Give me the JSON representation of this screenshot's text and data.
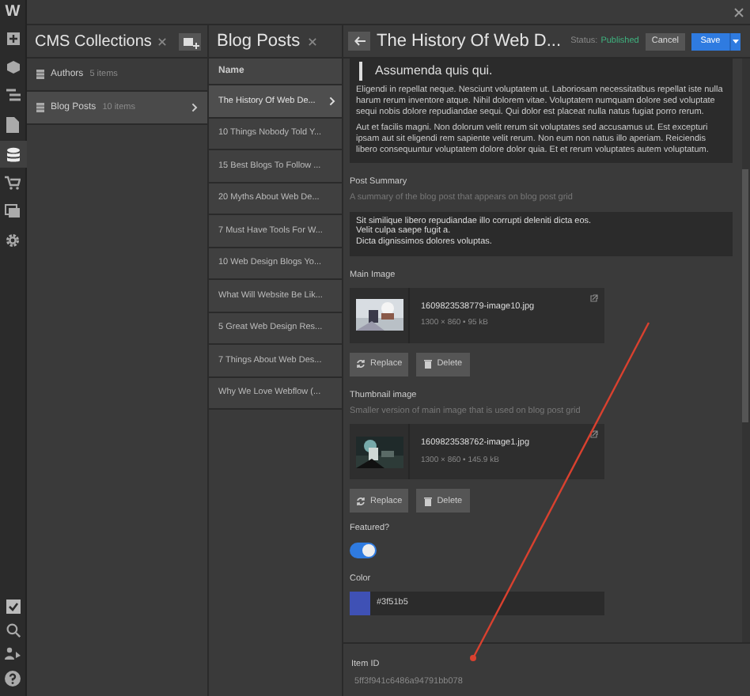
{
  "toolbar": {
    "logo": "W"
  },
  "collections_panel": {
    "title": "CMS Collections",
    "items": [
      {
        "name": "Authors",
        "count": "5 items",
        "selected": false
      },
      {
        "name": "Blog Posts",
        "count": "10 items",
        "selected": true
      }
    ]
  },
  "posts_panel": {
    "title": "Blog Posts",
    "column": "Name",
    "items": [
      {
        "name": "The History Of Web De...",
        "selected": true
      },
      {
        "name": "10 Things Nobody Told Y...",
        "selected": false
      },
      {
        "name": "15 Best Blogs To Follow ...",
        "selected": false
      },
      {
        "name": "20 Myths About Web De...",
        "selected": false
      },
      {
        "name": "7 Must Have Tools For W...",
        "selected": false
      },
      {
        "name": "10 Web Design Blogs Yo...",
        "selected": false
      },
      {
        "name": "What Will Website Be Lik...",
        "selected": false
      },
      {
        "name": "5 Great Web Design Res...",
        "selected": false
      },
      {
        "name": "7 Things About Web Des...",
        "selected": false
      },
      {
        "name": "Why We Love Webflow (...",
        "selected": false
      }
    ]
  },
  "editor": {
    "title": "The History Of Web D...",
    "status_label": "Status:",
    "status": "Published",
    "cancel": "Cancel",
    "save": "Save",
    "body": {
      "quote": "Assumenda quis qui.",
      "paragraphs": [
        "Eligendi in repellat neque. Nesciunt voluptatem ut. Laboriosam necessitatibus repellat iste nulla harum rerum inventore atque. Nihil dolorem vitae. Voluptatem numquam dolore sed voluptate sequi nobis dolore repudiandae sequi. Qui dolor est placeat nulla natus fugiat porro rerum.",
        "Aut et facilis magni. Non dolorum velit rerum sit voluptates sed accusamus ut. Est excepturi ipsam aut sit eligendi rem sapiente velit rerum. Non eum non natus illo aperiam. Reiciendis libero consequuntur voluptatem dolore dolor quia. Et et rerum voluptates autem voluptatum."
      ]
    },
    "post_summary": {
      "label": "Post Summary",
      "help": "A summary of the blog post that appears on blog post grid",
      "value": "Sit similique libero repudiandae illo corrupti deleniti dicta eos.\nVelit culpa saepe fugit a.\nDicta dignissimos dolores voluptas."
    },
    "main_image": {
      "label": "Main Image",
      "file": "1609823538779-image10.jpg",
      "meta": "1300 × 860 • 95 kB",
      "replace": "Replace",
      "delete": "Delete"
    },
    "thumbnail_image": {
      "label": "Thumbnail image",
      "help": "Smaller version of main image that is used on blog post grid",
      "file": "1609823538762-image1.jpg",
      "meta": "1300 × 860 • 145.9 kB",
      "replace": "Replace",
      "delete": "Delete"
    },
    "featured": {
      "label": "Featured?",
      "on": true
    },
    "color": {
      "label": "Color",
      "value": "#3f51b5",
      "color": "#3f51b5"
    },
    "item_id": {
      "label": "Item ID",
      "value": "5ff3f941c6486a94791bb078"
    }
  }
}
